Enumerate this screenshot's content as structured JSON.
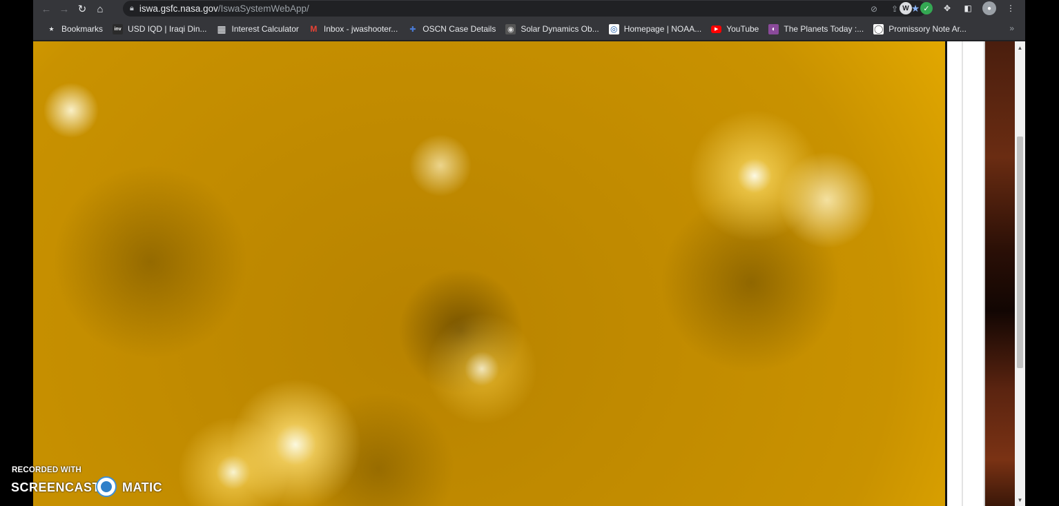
{
  "toolbar": {
    "back_icon": "←",
    "forward_icon": "→",
    "reload_icon": "↻",
    "home_icon": "⌂"
  },
  "omnibox": {
    "url_host": "iswa.gsfc.nasa.gov",
    "url_path": "/IswaSystemWebApp/"
  },
  "bookmarks": [
    {
      "label": "Bookmarks",
      "icon": "★",
      "icon_bg": "transparent",
      "icon_color": "#e8eaed"
    },
    {
      "label": "USD IQD | Iraqi Din...",
      "icon": "inv",
      "icon_bg": "#2b2b2b",
      "icon_color": "#ffffff"
    },
    {
      "label": "Interest Calculator",
      "icon": "▦",
      "icon_bg": "transparent",
      "icon_color": "#e8eaed"
    },
    {
      "label": "Inbox - jwashooter...",
      "icon": "M",
      "icon_bg": "transparent",
      "icon_color": "#ea4335"
    },
    {
      "label": "OSCN Case Details",
      "icon": "✚",
      "icon_bg": "transparent",
      "icon_color": "#4a7bd6"
    },
    {
      "label": "Solar Dynamics Ob...",
      "icon": "◉",
      "icon_bg": "#555555",
      "icon_color": "#dddddd"
    },
    {
      "label": "Homepage | NOAA...",
      "icon": "◎",
      "icon_bg": "#ffffff",
      "icon_color": "#1a5aa8"
    },
    {
      "label": "YouTube",
      "icon": "▶",
      "icon_bg": "#ff0000",
      "icon_color": "#ffffff"
    },
    {
      "label": "The Planets Today :...",
      "icon": "◐",
      "icon_bg": "#8a4a9a",
      "icon_color": "#ffffff"
    },
    {
      "label": "Promissory Note Ar...",
      "icon": "◯",
      "icon_bg": "#ffffff",
      "icon_color": "#555555"
    }
  ],
  "bookmarks_overflow": "»",
  "scrollbar": {
    "up_arrow": "▲",
    "down_arrow": "▼"
  },
  "watermark": {
    "recorded_with": "RECORDED WITH",
    "brand_left": "SCREENCAST",
    "brand_right": "MATIC"
  },
  "colors": {
    "toolbar_bg": "#35363a",
    "omnibox_bg": "#202124",
    "bookmark_star": "#8ab4f8",
    "solar_gold": "#c99200"
  }
}
